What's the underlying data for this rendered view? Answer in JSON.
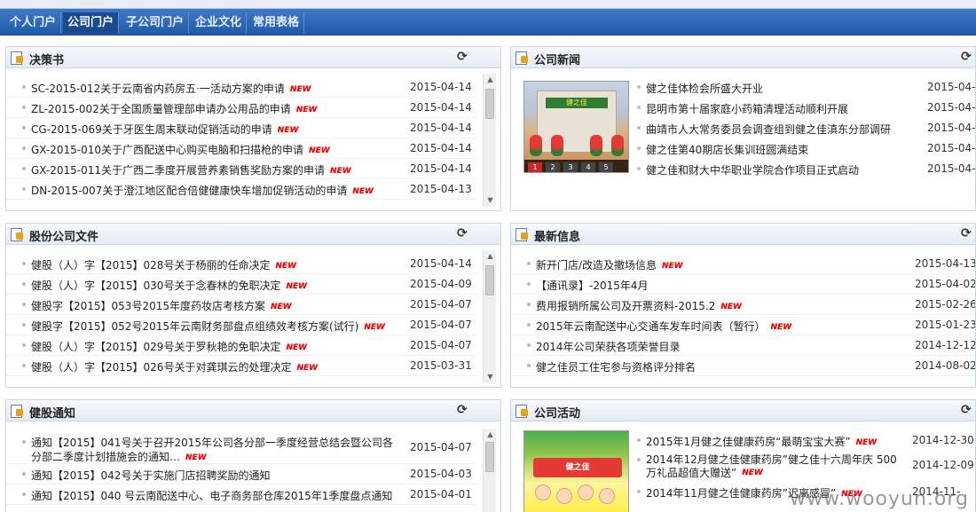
{
  "nav": {
    "tabs": [
      {
        "label": "个人门户",
        "active": false
      },
      {
        "label": "公司门户",
        "active": true
      },
      {
        "label": "子公司门户",
        "active": false
      },
      {
        "label": "企业文化",
        "active": false
      },
      {
        "label": "常用表格",
        "active": false
      }
    ]
  },
  "new_badge": "NEW",
  "refresh_icon": "⟳",
  "panels": {
    "decisions": {
      "title": "决策书",
      "items": [
        {
          "title": "SC-2015-012关于云南省内药房五·一活动方案的申请",
          "date": "2015-04-14",
          "new": true
        },
        {
          "title": "ZL-2015-002关于全国质量管理部申请办公用品的申请",
          "date": "2015-04-14",
          "new": true
        },
        {
          "title": "CG-2015-069关于牙医生周末联动促销活动的申请",
          "date": "2015-04-14",
          "new": true
        },
        {
          "title": "GX-2015-010关于广西配送中心购买电脑和扫描枪的申请",
          "date": "2015-04-14",
          "new": true
        },
        {
          "title": "GX-2015-011关于广西二季度开展营养素销售奖励方案的申请",
          "date": "2015-04-14",
          "new": true
        },
        {
          "title": "DN-2015-007关于澄江地区配合倍健健康快车增加促销活动的申请",
          "date": "2015-04-13",
          "new": true
        }
      ]
    },
    "company_news": {
      "title": "公司新闻",
      "image_sign": "健之佳",
      "pager": [
        "1",
        "2",
        "3",
        "4",
        "5"
      ],
      "items": [
        {
          "title": "健之佳体检会所盛大开业",
          "date": "2015-04-"
        },
        {
          "title": "昆明市第十届家庭小药箱清理活动顺利开展",
          "date": "2015-04-"
        },
        {
          "title": "曲靖市人大常务委员会调查组到健之佳滇东分部调研",
          "date": "2015-04-"
        },
        {
          "title": "健之佳第40期店长集训班圆满结束",
          "date": "2015-04-"
        },
        {
          "title": "健之佳和财大中华职业学院合作项目正式启动",
          "date": "2015-04-"
        }
      ]
    },
    "shareholding": {
      "title": "股份公司文件",
      "items": [
        {
          "title": "健股（人）字【2015】028号关于杨丽的任命决定",
          "date": "2015-04-14",
          "new": true
        },
        {
          "title": "健股（人）字【2015】030号关于念春林的免职决定",
          "date": "2015-04-09",
          "new": true
        },
        {
          "title": "健股字【2015】053号2015年度药妆店考核方案",
          "date": "2015-04-07",
          "new": true
        },
        {
          "title": "健股字【2015】052号2015年云南财务部盘点组绩效考核方案(试行)",
          "date": "2015-04-07",
          "new": true
        },
        {
          "title": "健股（人）字【2015】029号关于罗秋艳的免职决定",
          "date": "2015-04-07",
          "new": true
        },
        {
          "title": "健股（人）字【2015】026号关于对龚琪云的处理决定",
          "date": "2015-03-31",
          "new": true
        }
      ]
    },
    "latest_info": {
      "title": "最新信息",
      "items": [
        {
          "title": "新开门店/改造及撤场信息",
          "date": "2015-04-13",
          "new": true
        },
        {
          "title": "【通讯录】-2015年4月",
          "date": "2015-04-02",
          "new": false
        },
        {
          "title": "费用报销所属公司及开票资料-2015.2",
          "date": "2015-02-26",
          "new": true
        },
        {
          "title": "2015年云南配送中心交通车发车时间表（暂行）",
          "date": "2015-01-23",
          "new": true
        },
        {
          "title": "2014年公司荣获各项荣誉目录",
          "date": "2014-12-12",
          "new": false
        },
        {
          "title": "健之佳员工住宅参与资格评分排名",
          "date": "2014-08-02",
          "new": false
        }
      ]
    },
    "notices": {
      "title": "健股通知",
      "items": [
        {
          "title": "通知【2015】041号关于召开2015年公司各分部一季度经营总结会暨公司各",
          "title2": "分部二季度计划措施会的通知…",
          "date": "2015-04-07",
          "new": true
        },
        {
          "title": "通知【2015】042号关于实施门店招聘奖励的通知",
          "date": "2015-04-03",
          "new": false
        },
        {
          "title": "通知【2015】040 号云南配送中心、电子商务部仓库2015年1季度盘点通知",
          "date": "2015-04-01",
          "new": false
        }
      ]
    },
    "activities": {
      "title": "公司活动",
      "image_banner": "健之佳",
      "items": [
        {
          "title": "2015年1月健之佳健康药房“最萌宝宝大赛”",
          "date": "2014-12-30",
          "new": true
        },
        {
          "title": "2014年12月健之佳健康药房”健之佳十六周年庆 500",
          "title2": "万礼品超值大赠送”",
          "date": "2014-12-09",
          "new": true
        },
        {
          "title": "2014年11月健之佳健康药房”迟离感冒”",
          "date": "2014-11-",
          "new": true
        }
      ]
    }
  },
  "watermark": "www.wooyun.org"
}
